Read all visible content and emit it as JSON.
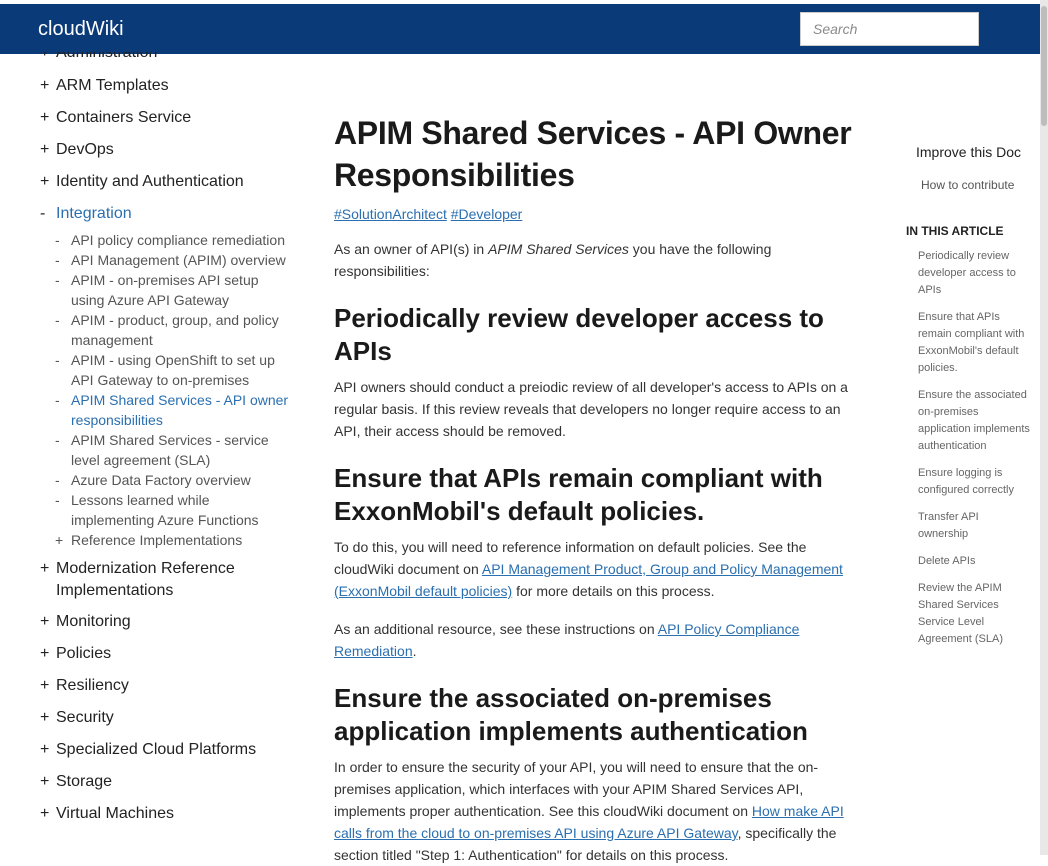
{
  "header": {
    "brand": "cloudWiki",
    "search_placeholder": "Search"
  },
  "leftnav": {
    "top_before": [
      {
        "sign": "+",
        "label": "Administration"
      },
      {
        "sign": "+",
        "label": "ARM Templates"
      },
      {
        "sign": "+",
        "label": "Containers Service"
      },
      {
        "sign": "+",
        "label": "DevOps"
      },
      {
        "sign": "+",
        "label": "Identity and Authentication"
      },
      {
        "sign": "-",
        "label": "Integration"
      }
    ],
    "sub": [
      {
        "sign": "-",
        "label": "API policy compliance remediation"
      },
      {
        "sign": "-",
        "label": "API Management (APIM) overview"
      },
      {
        "sign": "-",
        "label": "APIM - on-premises API setup using Azure API Gateway"
      },
      {
        "sign": "-",
        "label": "APIM - product, group, and policy management"
      },
      {
        "sign": "-",
        "label": "APIM - using OpenShift to set up API Gateway to on-premises"
      },
      {
        "sign": "-",
        "label": "APIM Shared Services - API owner responsibilities"
      },
      {
        "sign": "-",
        "label": "APIM Shared Services - service level agreement (SLA)"
      },
      {
        "sign": "-",
        "label": "Azure Data Factory overview"
      },
      {
        "sign": "-",
        "label": "Lessons learned while implementing Azure Functions"
      },
      {
        "sign": "+",
        "label": "Reference Implementations"
      }
    ],
    "top_after": [
      {
        "sign": "+",
        "label": "Modernization Reference Implementations"
      },
      {
        "sign": "+",
        "label": "Monitoring"
      },
      {
        "sign": "+",
        "label": "Policies"
      },
      {
        "sign": "+",
        "label": "Resiliency"
      },
      {
        "sign": "+",
        "label": "Security"
      },
      {
        "sign": "+",
        "label": "Specialized Cloud Platforms"
      },
      {
        "sign": "+",
        "label": "Storage"
      },
      {
        "sign": "+",
        "label": "Virtual Machines"
      }
    ]
  },
  "article": {
    "title": "APIM Shared Services - API Owner Responsibilities",
    "tag1": "#SolutionArchitect",
    "tag2": "#Developer",
    "intro_a": "As an owner of API(s) in ",
    "intro_em": "APIM Shared Services",
    "intro_b": " you have the following responsibilities:",
    "s1_title": "Periodically review developer access to APIs",
    "s1_body": "API owners should conduct a preiodic review of all developer's access to APIs on a regular basis. If this review reveals that developers no longer require access to an API, their access should be removed.",
    "s2_title": "Ensure that APIs remain compliant with ExxonMobil's default policies.",
    "s2_body_a": "To do this, you will need to reference information on default policies. See the cloudWiki document on ",
    "s2_link": "API Management Product, Group and Policy Management (ExxonMobil default policies)",
    "s2_body_b": " for more details on this process.",
    "s2_body2_a": "As an additional resource, see these instructions on ",
    "s2_link2": "API Policy Compliance Remediation",
    "s2_body2_b": ".",
    "s3_title": "Ensure the associated on-premises application implements authentication",
    "s3_body_a": "In order to ensure the security of your API, you will need to ensure that the on-premises application, which interfaces with your APIM Shared Services API, implements proper authentication. See this cloudWiki document on ",
    "s3_link": "How make API calls from the cloud to on-premises API using Azure API Gateway",
    "s3_body_b": ", specifically the section titled \"Step 1: Authentication\" for details on this process."
  },
  "rail": {
    "improve": "Improve this Doc",
    "contribute": "How to contribute",
    "in_article": "IN THIS ARTICLE",
    "toc": [
      "Periodically review developer access to APIs",
      "Ensure that APIs remain compliant with ExxonMobil's default policies.",
      "Ensure the associated on-premises application implements authentication",
      "Ensure logging is configured correctly",
      "Transfer API ownership",
      "Delete APIs",
      "Review the APIM Shared Services Service Level Agreement (SLA)"
    ]
  }
}
